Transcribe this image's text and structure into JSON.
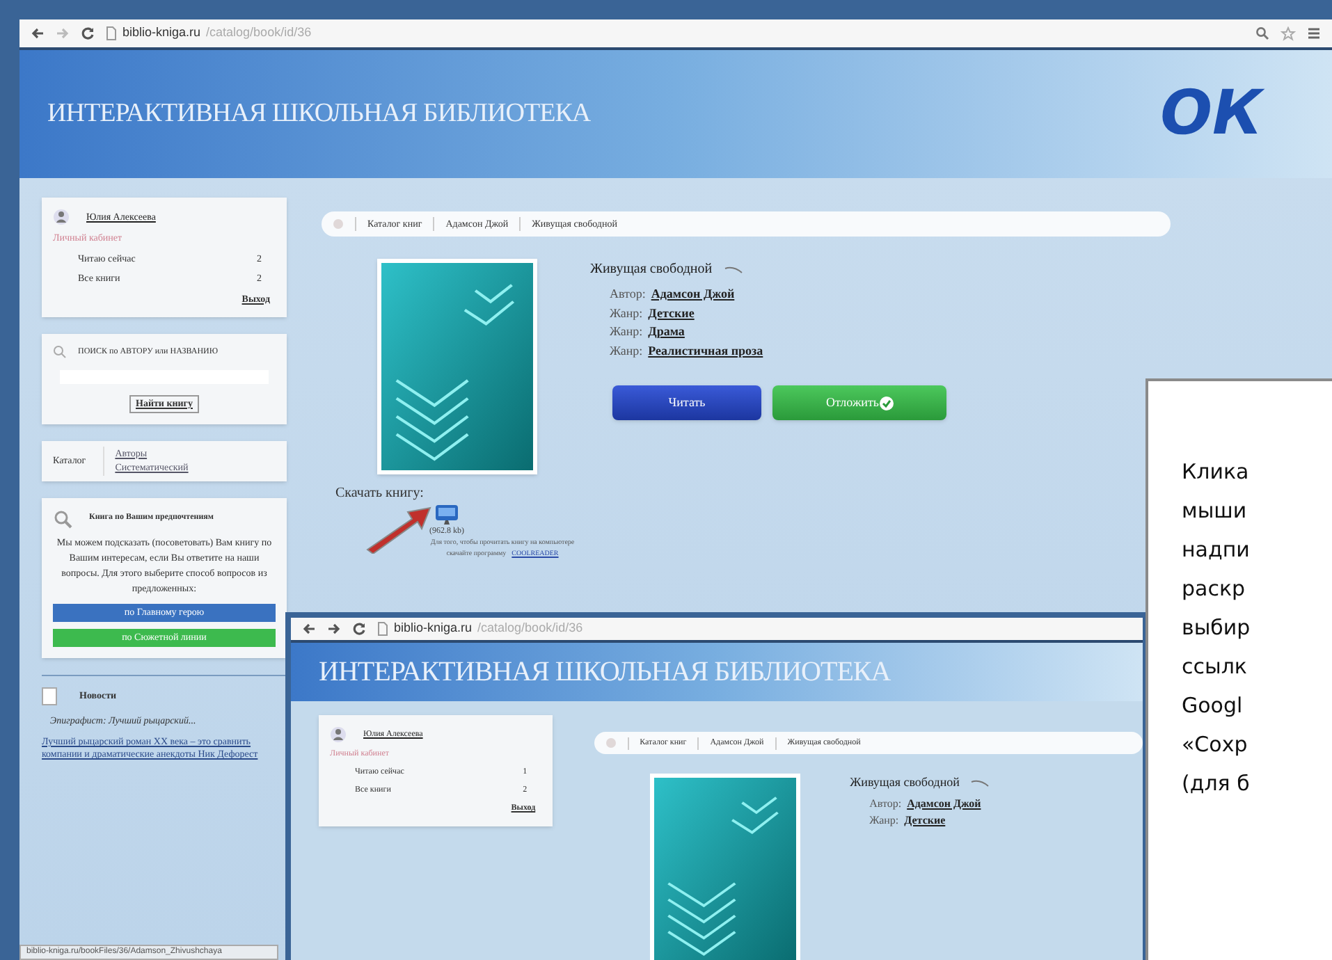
{
  "browser": {
    "url_host": "biblio-kniga.ru",
    "url_path": "/catalog/book/id/36"
  },
  "site_title": "ИНТЕРАКТИВНАЯ ШКОЛЬНАЯ БИБЛИОТЕКА",
  "logo_text": "ОК",
  "user_panel": {
    "name": "Юлия Алексеева",
    "cabinet": "Личный кабинет",
    "stats": [
      {
        "label": "Читаю сейчас",
        "value": "2"
      },
      {
        "label": "Все книги",
        "value": "2"
      }
    ],
    "logout": "Выход"
  },
  "search_panel": {
    "title": "ПОИСК по АВТОРУ или НАЗВАНИЮ",
    "button": "Найти книгу"
  },
  "catalog_panel": {
    "label": "Каталог",
    "links": [
      "Авторы",
      "Систематический"
    ]
  },
  "recommend_panel": {
    "title": "Книга по Вашим предпочтениям",
    "text": "Мы можем подсказать (посоветовать) Вам книгу по Вашим интересам, если Вы ответите на наши вопросы. Для этого выберите способ вопросов из предложенных:",
    "buttons": [
      {
        "label": "по Главному герою",
        "color": "#3a72c0"
      },
      {
        "label": "по Сюжетной линии",
        "color": "#3dba4e"
      }
    ]
  },
  "news_panel": {
    "title": "Новости",
    "headline": "Эпиграфист: Лучший рыцарский...",
    "text": "Лучший рыцарский роман XX века – это сравнить компании и драматические анекдоты Ник Дефорест"
  },
  "status_bar": "biblio-kniga.ru/bookFiles/36/Adamson_Zhivushchaya",
  "breadcrumbs": [
    "Каталог книг",
    "Адамсон Джой",
    "Живущая свободной"
  ],
  "book": {
    "title": "Живущая свободной",
    "fields": [
      {
        "label": "Автор:",
        "value": "Адамсон Джой"
      },
      {
        "label": "Жанр:",
        "value": "Детские"
      },
      {
        "label": "Жанр:",
        "value": "Драма"
      },
      {
        "label": "Жанр:",
        "value": "Реалистичная проза"
      }
    ],
    "buttons": [
      {
        "label": "Читать",
        "kind": "read"
      },
      {
        "label": "Отложить",
        "kind": "save"
      }
    ],
    "download_label": "Скачать книгу:",
    "file_size": "(962.8 kb)",
    "note": "Для того, чтобы прочитать книгу на компьютере",
    "note_link": "COOLREADER",
    "note_prefix": "скачайте программу"
  },
  "inset": {
    "url_host": "biblio-kniga.ru",
    "url_path": "/catalog/book/id/36",
    "site_title": "ИНТЕРАКТИВНАЯ ШКОЛЬНАЯ БИБЛИОТЕКА",
    "user_name": "Юлия Алексеева",
    "cabinet": "Личный кабинет",
    "stats": [
      {
        "label": "Читаю сейчас",
        "value": "1"
      },
      {
        "label": "Все книги",
        "value": "2"
      }
    ],
    "logout": "Выход",
    "breadcrumbs": [
      "Каталог книг",
      "Адамсон Джой",
      "Живущая свободной"
    ],
    "book_title": "Живущая свободной",
    "fields": [
      {
        "label": "Автор:",
        "value": "Адамсон Джой"
      },
      {
        "label": "Жанр:",
        "value": "Детские"
      }
    ]
  },
  "callout": {
    "lines": [
      "Клика",
      "мыши",
      "надпи",
      "раскр",
      "выбир",
      "ссылк",
      "Googl",
      "«Сохр",
      "(для б"
    ]
  }
}
